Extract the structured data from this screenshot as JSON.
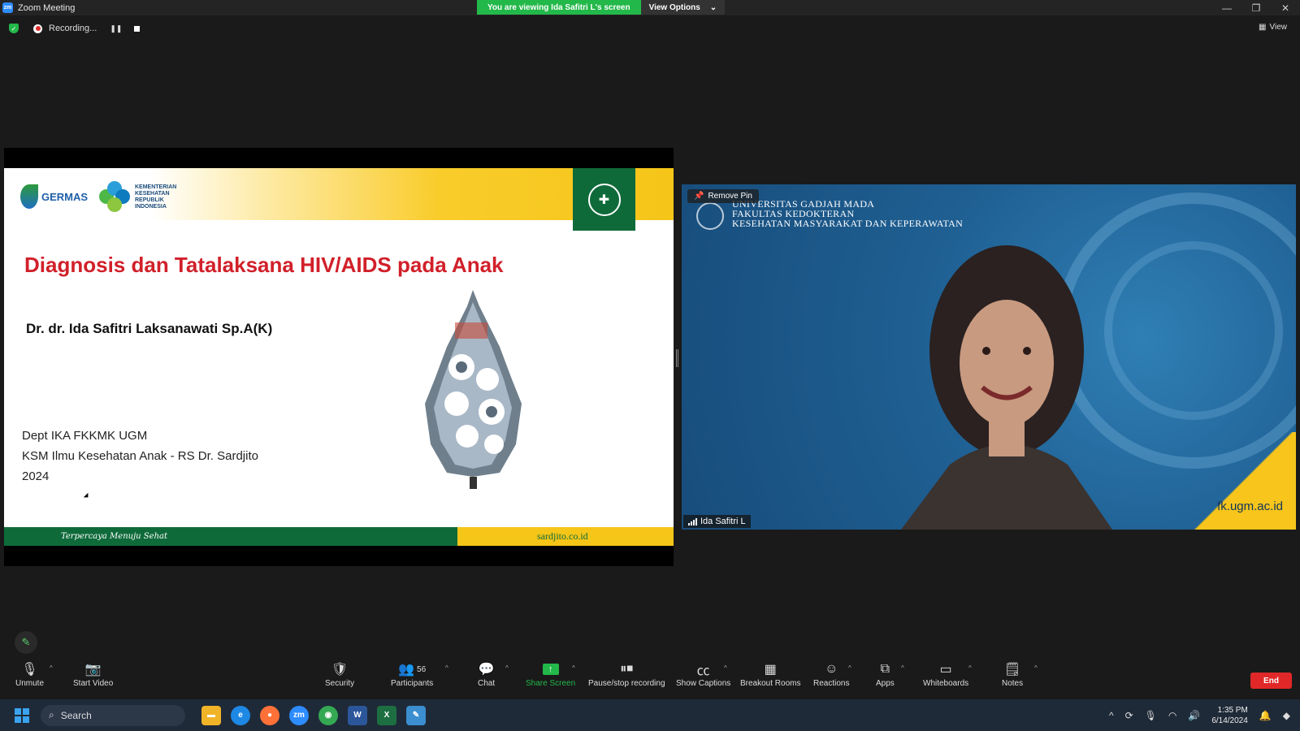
{
  "window": {
    "title": "Zoom Meeting",
    "logo": "zm",
    "viewing_banner": "You are viewing Ida Safitri L's screen",
    "view_options": "View Options"
  },
  "recording": {
    "label": "Recording..."
  },
  "top_right": {
    "view_label": "View"
  },
  "slide": {
    "germas_label": "GERMAS",
    "kemkes_lines": [
      "KEMENTERIAN",
      "KESEHATAN",
      "REPUBLIK",
      "INDONESIA"
    ],
    "title": "Diagnosis dan Tatalaksana HIV/AIDS pada Anak",
    "author": "Dr. dr. Ida Safitri Laksanawati Sp.A(K)",
    "affiliation": [
      "Dept IKA FKKMK UGM",
      "KSM Ilmu Kesehatan Anak - RS Dr. Sardjito",
      "2024"
    ],
    "footer_tagline": "Terpercaya Menuju Sehat",
    "footer_site": "sardjito.co.id"
  },
  "video": {
    "remove_pin": "Remove Pin",
    "uni_lines": [
      "UNIVERSITAS GADJAH MADA",
      "FAKULTAS KEDOKTERAN",
      "KESEHATAN MASYARAKAT DAN KEPERAWATAN"
    ],
    "site": "fk.ugm.ac.id",
    "participant_name": "Ida Safitri L"
  },
  "toolbar": {
    "unmute": "Unmute",
    "start_video": "Start Video",
    "security": "Security",
    "participants": "Participants",
    "participant_count": "56",
    "chat": "Chat",
    "share_screen": "Share Screen",
    "pause_recording": "Pause/stop recording",
    "show_captions": "Show Captions",
    "breakout_rooms": "Breakout Rooms",
    "reactions": "Reactions",
    "apps": "Apps",
    "whiteboards": "Whiteboards",
    "notes": "Notes",
    "end": "End"
  },
  "taskbar": {
    "search_placeholder": "Search",
    "apps": [
      {
        "name": "file-explorer",
        "color": "#f0b429"
      },
      {
        "name": "edge",
        "color": "#1e88e5"
      },
      {
        "name": "firefox",
        "color": "#ff7139"
      },
      {
        "name": "zoom",
        "color": "#2d8cff"
      },
      {
        "name": "chrome",
        "color": "#34a853"
      },
      {
        "name": "word",
        "color": "#2b579a"
      },
      {
        "name": "excel",
        "color": "#1d6f42"
      },
      {
        "name": "paint",
        "color": "#3b8ed0"
      }
    ],
    "time": "1:35 PM",
    "date": "6/14/2024"
  },
  "colors": {
    "zoom_green": "#23b84a",
    "end_red": "#e02828",
    "slide_title_red": "#d1202a",
    "sardjito_green": "#0f6a3a",
    "sardjito_yellow": "#f5c518"
  }
}
